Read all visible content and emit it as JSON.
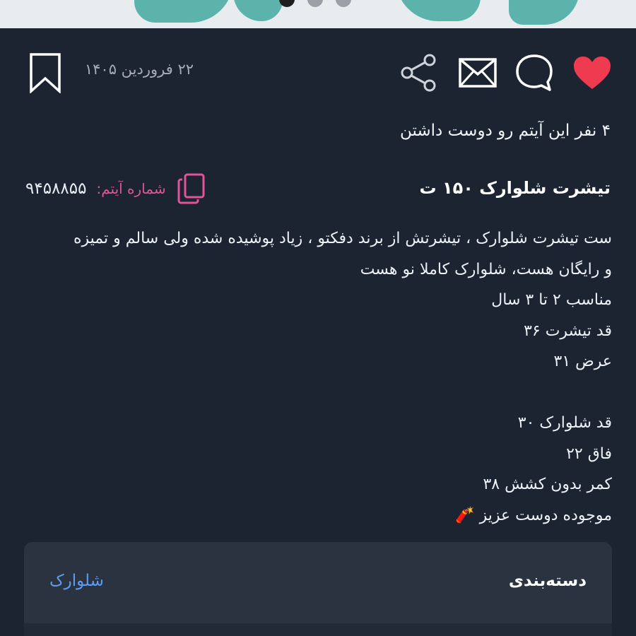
{
  "listing": {
    "date": "۲۲ فروردین ۱۴۰۵",
    "likes_text": "۴ نفر این آیتم رو دوست داشتن",
    "title": "تیشرت شلوارک ۱۵۰ ت",
    "item_number_label": "شماره آیتم:",
    "item_number": "۹۴۵۸۸۵۵",
    "description_lines": [
      "ست تیشرت شلوارک ، تیشرتش از برند دفکتو ، زیاد پوشیده شده ولی سالم و تمیزه",
      "و رایگان هست، شلوارک کاملا نو هست",
      "مناسب ۲ تا ۳ سال",
      "قد تیشرت ۳۶",
      "عرض ۳۱",
      "",
      "قد شلوارک ۳۰",
      "فاق ۲۲",
      "کمر بدون کشش ۳۸",
      "موجوده دوست عزیز 🧨"
    ]
  },
  "category": {
    "label": "دسته‌بندی",
    "value": "شلوارک"
  },
  "icons": {
    "bookmark": "bookmark-icon",
    "heart": "heart-icon",
    "chat": "chat-icon",
    "mail": "mail-icon",
    "share": "share-icon",
    "copy": "copy-icon"
  },
  "colors": {
    "background": "#1b2430",
    "heart": "#ef3b50",
    "item_label": "#e0559a",
    "link": "#5b9cf2"
  }
}
